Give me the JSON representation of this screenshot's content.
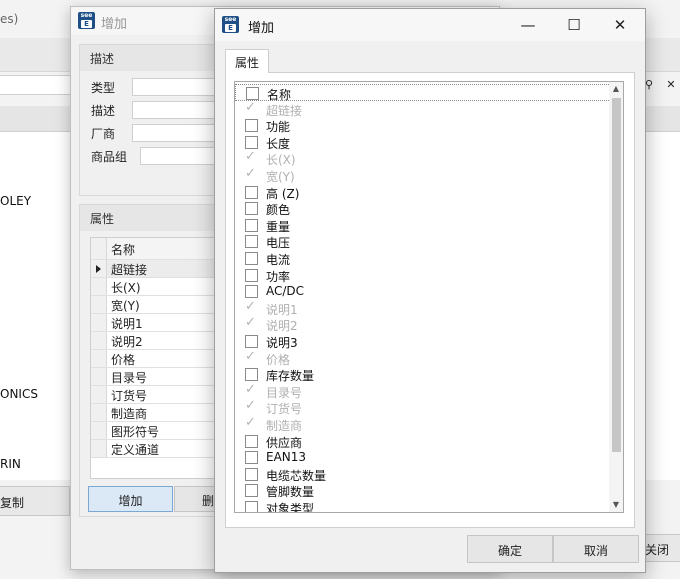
{
  "main_window": {
    "title": "es)",
    "left_list": [
      "OLEY",
      "ONICS",
      "RIN"
    ],
    "copy_button": "复制",
    "close_button": "关闭",
    "tool_icons": [
      "search-icon",
      "close-icon"
    ]
  },
  "mid_dialog": {
    "title": "增加",
    "description_group": {
      "header": "描述",
      "fields": [
        {
          "label": "类型",
          "value": ""
        },
        {
          "label": "描述",
          "value": ""
        },
        {
          "label": "厂商",
          "value": ""
        },
        {
          "label": "商品组",
          "value": ""
        }
      ]
    },
    "properties_group": {
      "header": "属性",
      "column_header": "名称",
      "rows": [
        "超链接",
        "长(X)",
        "宽(Y)",
        "说明1",
        "说明2",
        "价格",
        "目录号",
        "订货号",
        "制造商",
        "图形符号",
        "定义通道"
      ],
      "selected_row": 0
    },
    "buttons": {
      "add": "增加",
      "delete_partial": "删"
    }
  },
  "front_dialog": {
    "title": "增加",
    "tab": "属性",
    "items": [
      {
        "label": "名称",
        "checked": false,
        "disabled": false,
        "focus": true
      },
      {
        "label": "超链接",
        "checked": true,
        "disabled": true
      },
      {
        "label": "功能",
        "checked": false,
        "disabled": false
      },
      {
        "label": "长度",
        "checked": false,
        "disabled": false
      },
      {
        "label": "长(X)",
        "checked": true,
        "disabled": true
      },
      {
        "label": "宽(Y)",
        "checked": true,
        "disabled": true
      },
      {
        "label": "高 (Z)",
        "checked": false,
        "disabled": false
      },
      {
        "label": "颜色",
        "checked": false,
        "disabled": false
      },
      {
        "label": "重量",
        "checked": false,
        "disabled": false
      },
      {
        "label": "电压",
        "checked": false,
        "disabled": false
      },
      {
        "label": "电流",
        "checked": false,
        "disabled": false
      },
      {
        "label": "功率",
        "checked": false,
        "disabled": false
      },
      {
        "label": "AC/DC",
        "checked": false,
        "disabled": false
      },
      {
        "label": "说明1",
        "checked": true,
        "disabled": true
      },
      {
        "label": "说明2",
        "checked": true,
        "disabled": true
      },
      {
        "label": "说明3",
        "checked": false,
        "disabled": false
      },
      {
        "label": "价格",
        "checked": true,
        "disabled": true
      },
      {
        "label": "库存数量",
        "checked": false,
        "disabled": false
      },
      {
        "label": "目录号",
        "checked": true,
        "disabled": true
      },
      {
        "label": "订货号",
        "checked": true,
        "disabled": true
      },
      {
        "label": "制造商",
        "checked": true,
        "disabled": true
      },
      {
        "label": "供应商",
        "checked": false,
        "disabled": false
      },
      {
        "label": "EAN13",
        "checked": false,
        "disabled": false
      },
      {
        "label": "电缆芯数量",
        "checked": false,
        "disabled": false
      },
      {
        "label": "管脚数量",
        "checked": false,
        "disabled": false
      },
      {
        "label": "对象类型",
        "checked": false,
        "disabled": false
      }
    ],
    "buttons": {
      "ok": "确定",
      "cancel": "取消"
    },
    "window_controls": {
      "minimize": "—",
      "maximize": "☐",
      "close": "✕"
    }
  }
}
